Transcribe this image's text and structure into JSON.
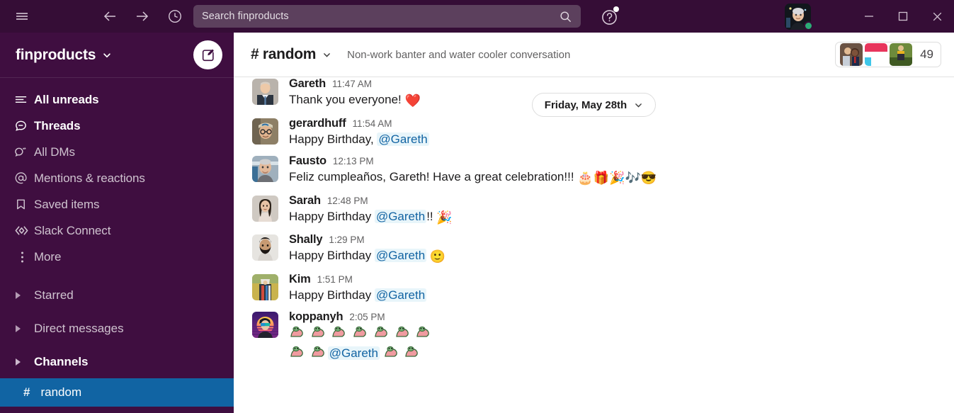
{
  "window": {
    "minimize_label": "Minimize",
    "maximize_label": "Maximize",
    "close_label": "Close"
  },
  "topbar": {
    "menu_icon": "hamburger-icon",
    "back_icon": "arrow-left-icon",
    "forward_icon": "arrow-right-icon",
    "history_icon": "clock-icon",
    "search_placeholder": "Search finproducts",
    "search_icon": "search-icon",
    "help_icon": "question-mark-icon",
    "avatar_name": "user-avatar"
  },
  "sidebar": {
    "workspace_name": "finproducts",
    "workspace_caret": "chevron-down-icon",
    "compose_label": "New message",
    "nav_items": [
      {
        "label": "All unreads",
        "icon": "unreads-icon",
        "bold": true
      },
      {
        "label": "Threads",
        "icon": "threads-icon",
        "bold": true
      },
      {
        "label": "All DMs",
        "icon": "dms-icon",
        "bold": false
      },
      {
        "label": "Mentions & reactions",
        "icon": "at-icon",
        "bold": false
      },
      {
        "label": "Saved items",
        "icon": "bookmark-icon",
        "bold": false
      },
      {
        "label": "Slack Connect",
        "icon": "slack-connect-icon",
        "bold": false
      },
      {
        "label": "More",
        "icon": "more-vertical-icon",
        "bold": false
      }
    ],
    "sections": [
      {
        "label": "Starred",
        "bold": false
      },
      {
        "label": "Direct messages",
        "bold": false
      },
      {
        "label": "Channels",
        "bold": true
      }
    ],
    "channels": [
      {
        "hash": "#",
        "name": "random",
        "active": true
      }
    ]
  },
  "channel": {
    "name": "# random",
    "caret": "chevron-down-icon",
    "topic": "Non-work banter and water cooler conversation",
    "member_count": "49"
  },
  "date_divider": {
    "label": "Friday, May 28th",
    "caret": "chevron-down-icon"
  },
  "messages": [
    {
      "user": "Gareth",
      "time": "11:47 AM",
      "text": "Thank you everyone! ",
      "emoji": "❤️",
      "mention": "",
      "text_after": ""
    },
    {
      "user": "gerardhuff",
      "time": "11:54 AM",
      "text": "Happy Birthday, ",
      "emoji": "",
      "mention": "@Gareth",
      "text_after": ""
    },
    {
      "user": "Fausto",
      "time": "12:13 PM",
      "text": "Feliz cumpleaños, Gareth! Have a great celebration!!!  ",
      "emoji": "🎂🎁🎉🎶😎",
      "mention": "",
      "text_after": ""
    },
    {
      "user": "Sarah",
      "time": "12:48 PM",
      "text": "Happy Birthday ",
      "emoji": "🎉",
      "mention": "@Gareth",
      "text_after": "!! "
    },
    {
      "user": "Shally",
      "time": "1:29 PM",
      "text": "Happy Birthday ",
      "emoji": "🙂",
      "mention": "@Gareth",
      "text_after": " "
    },
    {
      "user": "Kim",
      "time": "1:51 PM",
      "text": "Happy Birthday ",
      "emoji": "",
      "mention": "@Gareth",
      "text_after": ""
    },
    {
      "user": "koppanyh",
      "time": "2:05 PM",
      "text": "",
      "emoji": "",
      "mention": "@Gareth",
      "text_after": ""
    }
  ],
  "colors": {
    "sidebar_bg": "#3F0E40",
    "topbar_bg": "#350D36",
    "active_channel_bg": "#1164A3",
    "mention_text": "#1264A3",
    "mention_bg": "#E8F5FA",
    "presence_green": "#2BAC76"
  }
}
